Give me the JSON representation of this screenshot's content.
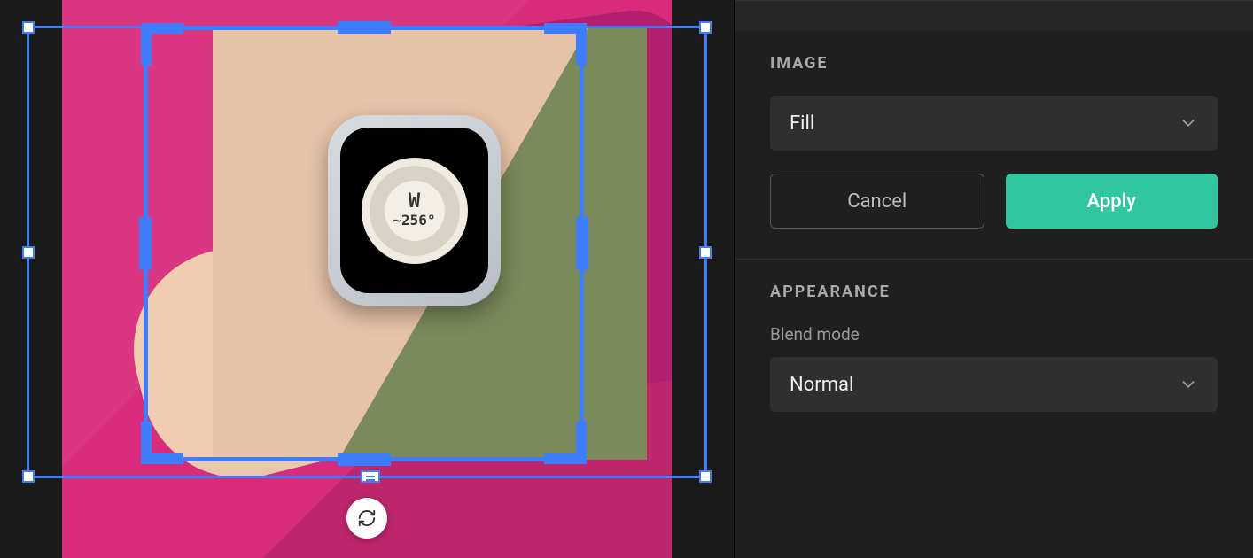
{
  "canvas": {
    "watch_direction": "W",
    "watch_heading": "~256°"
  },
  "panel": {
    "image_section_title": "IMAGE",
    "fill_mode": "Fill",
    "cancel_label": "Cancel",
    "apply_label": "Apply",
    "appearance_section_title": "APPEARANCE",
    "blend_mode_label": "Blend mode",
    "blend_mode_value": "Normal"
  }
}
